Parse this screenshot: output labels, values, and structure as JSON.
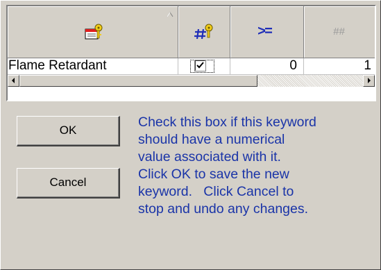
{
  "grid": {
    "columns": [
      {
        "icon": "keyword-icon"
      },
      {
        "icon": "numeric-keyword-icon"
      },
      {
        "icon": "greater-equal-icon",
        "label": ">="
      },
      {
        "icon": "placeholder-number-icon",
        "label": "##"
      }
    ],
    "row": {
      "keyword": "Flame Retardant",
      "numeric_checked": true,
      "min_value": "0",
      "default_value": "1"
    }
  },
  "buttons": {
    "ok": "OK",
    "cancel": "Cancel"
  },
  "help_lines": [
    "Check this box if this keyword",
    "should have a numerical",
    "value associated with it.",
    "Click OK to save the new",
    "keyword.   Click Cancel to",
    "stop and undo any changes."
  ],
  "colors": {
    "window": "#d4d0c8",
    "help_text": "#1a34a8",
    "operator_blue": "#1f2eb8"
  }
}
